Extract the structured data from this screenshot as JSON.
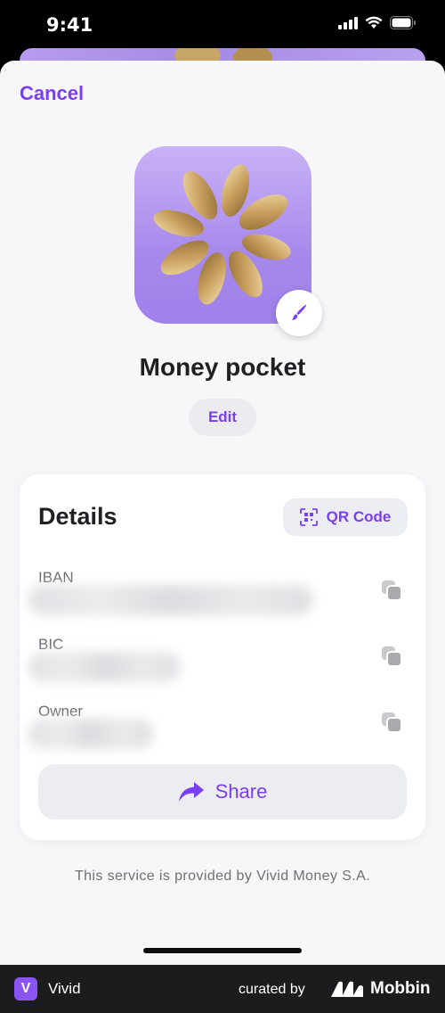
{
  "status_bar": {
    "time": "9:41"
  },
  "header": {
    "cancel_label": "Cancel"
  },
  "pocket": {
    "title": "Money pocket",
    "edit_label": "Edit"
  },
  "details": {
    "heading": "Details",
    "qr_label": "QR Code",
    "fields": [
      {
        "label": "IBAN"
      },
      {
        "label": "BIC"
      },
      {
        "label": "Owner"
      }
    ],
    "share_label": "Share"
  },
  "footer": {
    "note": "This service is provided by Vivid Money S.A."
  },
  "bottom_bar": {
    "app_badge": "V",
    "app_name": "Vivid",
    "curated_by": "curated by",
    "brand": "Mobbin"
  },
  "colors": {
    "accent": "#7a3ff0",
    "card_bg": "#ffffff",
    "sheet_bg": "#f7f7f9",
    "icon_bg": "#a789ec"
  }
}
